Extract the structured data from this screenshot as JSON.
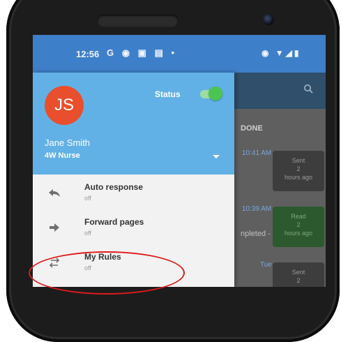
{
  "status_bar": {
    "time": "12:56",
    "left_icons": "G ◉ ▣ ▤ •",
    "right_icons": "◉ ▼◢▮"
  },
  "background_app": {
    "column_header": "DONE",
    "entries": [
      {
        "time": "10:41 AM",
        "card_lines": [
          "Sent",
          "2",
          "hours ago"
        ],
        "kind": "sent"
      },
      {
        "time": "10:39 AM",
        "card_lines": [
          "Read",
          "2",
          "hours ago"
        ],
        "kind": "read"
      },
      {
        "time": "Tue",
        "card_lines": [
          "Sent",
          "2"
        ],
        "kind": "sent"
      }
    ],
    "partial_text": "npleted -"
  },
  "drawer": {
    "avatar_initials": "JS",
    "status_label": "Status",
    "status_on": true,
    "user_name": "Jane Smith",
    "user_role": "4W Nurse",
    "items": [
      {
        "label": "Auto response",
        "sub": "off",
        "icon": "reply-icon"
      },
      {
        "label": "Forward pages",
        "sub": "off",
        "icon": "forward-icon"
      },
      {
        "label": "My Rules",
        "sub": "off",
        "icon": "swap-arrows-icon"
      }
    ]
  },
  "colors": {
    "status_bar": "#3e7fc9",
    "drawer_header": "#62b1e6",
    "avatar": "#e94f2c",
    "toggle_on": "#4cc451",
    "highlight": "#e01b1b"
  }
}
